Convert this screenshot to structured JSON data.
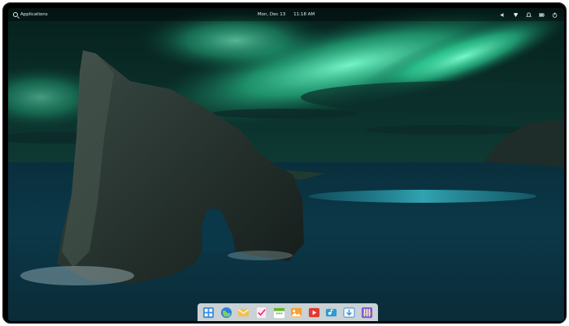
{
  "panel": {
    "applications_label": "Applications",
    "date": "Mon, Dec 13",
    "time": "11:18 AM"
  },
  "indicators": [
    {
      "icon": "volume-icon"
    },
    {
      "icon": "network-icon"
    },
    {
      "icon": "notifications-icon"
    },
    {
      "icon": "battery-icon"
    },
    {
      "icon": "power-icon"
    }
  ],
  "dock": [
    {
      "icon": "file-manager-icon"
    },
    {
      "icon": "web-browser-icon"
    },
    {
      "icon": "mail-icon"
    },
    {
      "icon": "tasks-icon"
    },
    {
      "icon": "calendar-icon"
    },
    {
      "icon": "photos-icon"
    },
    {
      "icon": "videos-icon"
    },
    {
      "icon": "music-icon"
    },
    {
      "icon": "app-center-icon"
    },
    {
      "icon": "system-settings-icon"
    }
  ],
  "colors": {
    "aurora": "#3cf0b0",
    "sea": "#0d3a4a",
    "rock": "#2c3a36",
    "panel_text": "#e6eef0"
  }
}
